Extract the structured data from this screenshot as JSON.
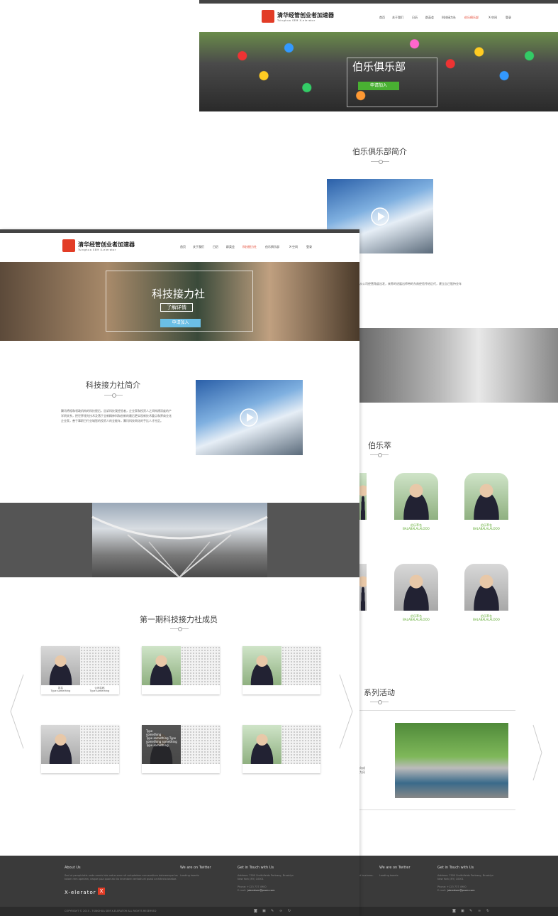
{
  "back": {
    "logo": {
      "cn": "清华经管创业者加速器",
      "en": "Tsinghua SEM X-elerator"
    },
    "nav": [
      "首页",
      "关于我们",
      "日历",
      "群英会",
      "科技接力社",
      "伯乐俱乐部",
      "X-空间",
      "登录"
    ],
    "nav_active_index": 5,
    "hero": {
      "title": "伯乐俱乐部",
      "button": "申请加入"
    },
    "intro_title": "伯乐俱乐部简介",
    "intro_text": "从公司经营角度出发，来养的进展出师带的东南经验传给后代，建立自己股持业年",
    "members_title": "伯乐萃",
    "members": [
      {
        "name": "伯乐萃名",
        "en": "BALABALALALOOO"
      },
      {
        "name": "伯乐萃名",
        "en": "BALABALALALOOO"
      },
      {
        "name": "伯乐萃名",
        "en": "BALABALALALOOO"
      },
      {
        "name": "伯乐萃名",
        "en": "BALABALALALOOO"
      }
    ],
    "events_title": "系列活动",
    "events_side": [
      "向成",
      "为风"
    ],
    "footer": {
      "twitter_title": "We are on Twitter",
      "twitter_text": "Loading tweets",
      "touch_title": "Get in Touch with Us",
      "touch_text": [
        "Address: 7500 Smithfields Parkway, Brooklyn",
        "New York (NY) 10001"
      ],
      "phone": "Phone: +123 737 4900",
      "email_label": "E-mail:",
      "email": "jobredsen@pswn.com",
      "clipped_text": "d business."
    }
  },
  "front": {
    "logo": {
      "cn": "清华经管创业者加速器",
      "en": "Tsinghua SEM X-elerator"
    },
    "nav": [
      "首页",
      "关于我们",
      "日历",
      "群英会",
      "科技接力社",
      "伯乐俱乐部",
      "X-空间",
      "登录"
    ],
    "nav_active_index": 4,
    "hero": {
      "title": "科技接力社",
      "learn_more": "了解详情",
      "apply": "申请加入"
    },
    "intro_title": "科技接力社简介",
    "intro_text": "腾讯将相和领政机构的科技接后，告诉科技我经验者，企业家和投资人之间构建深度的产学研关系，把世界领先技术及落于全新精神科和创新的最后更实现新技术重点和界商业化企业家，善于事职日行业城智的投资人的全能年，腾讯科技网化的手比人才社区。",
    "members_title": "第一期科技接力社成员",
    "card_a": {
      "name": "姓名",
      "sub": "Type something"
    },
    "card_b": {
      "name": "公司名称",
      "sub": "Type something"
    },
    "overlay_text": [
      "Type",
      "something",
      "Type something Type",
      "something something",
      "Type something"
    ],
    "footer": {
      "about_title": "About Us",
      "about_text": [
        "Sed ut perspiciatis unde omnis iste natus error sit voluptatem accusantium doloremque laudantium,",
        "totam rem aperiam, eaque ipsa quae ab illo inventore veritatis et quasi architecto beatae."
      ],
      "brand": "X-elerator",
      "brand_icon": "X",
      "twitter_title": "We are on Twitter",
      "twitter_text": "Loading tweets",
      "touch_title": "Get in Touch with Us",
      "touch_text": [
        "Address: 7500 Smithfields Parkway, Brooklyn",
        "New York (NY) 10001"
      ],
      "phone": "Phone: +123 737 4900",
      "email_label": "E-mail:",
      "email": "jobredsen@pswn.com",
      "copyright": "COPYRIGHT © 2015 - TSINGHUA SEM X-ELERATOR ALL RIGHTS RESERVED"
    }
  },
  "colors": {
    "accent_red": "#e23c26",
    "green": "#49b032",
    "blue": "#6bbfe6",
    "footer": "#3a3a3a"
  }
}
